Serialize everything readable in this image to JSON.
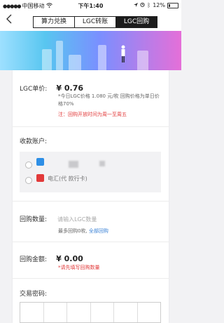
{
  "status_bar": {
    "carrier": "中国移动",
    "time": "下午1:40",
    "battery": "12%"
  },
  "nav": {
    "back_icon": "chevron-left-icon",
    "tabs": [
      {
        "label": "算力兑换",
        "active": false
      },
      {
        "label": "LGC转账",
        "active": false
      },
      {
        "label": "LGC回购",
        "active": true
      }
    ]
  },
  "price": {
    "label": "LGC单价:",
    "value": "¥ 0.76",
    "note": "*今日LGC价格 1.080 元/枚 回购价格为单日价格70%",
    "notice": "注：回购开放时间为周一至周五"
  },
  "account": {
    "label": "收款账户:",
    "option_2_text": "电汇(代                  款行卡)"
  },
  "quantity": {
    "label": "回购数量:",
    "placeholder": "请输入LGC数量",
    "hint": "最多回购0枚,",
    "all_link": "全部回购"
  },
  "amount": {
    "label": "回购金额:",
    "value": "¥ 0.00",
    "note": "*请先填写回购数量"
  },
  "password": {
    "label": "交易密码:"
  },
  "colors": {
    "accent_red": "#e23a3a",
    "link_blue": "#3b82d6",
    "tab_active": "#1c1c1c"
  }
}
